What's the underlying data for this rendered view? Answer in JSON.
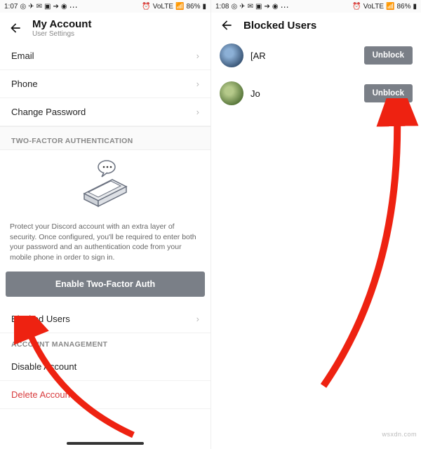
{
  "left": {
    "status": {
      "time": "1:07",
      "battery": "86%",
      "net": "VoLTE"
    },
    "title": "My Account",
    "subtitle": "User Settings",
    "rows": {
      "email_label": "Email",
      "email_value": "",
      "phone_label": "Phone",
      "password_label": "Change Password"
    },
    "twofa_header": "TWO-FACTOR AUTHENTICATION",
    "twofa_desc": "Protect your Discord account with an extra layer of security. Once configured, you'll be required to enter both your password and an authentication code from your mobile phone in order to sign in.",
    "enable_btn": "Enable Two-Factor Auth",
    "blocked_label": "Blocked Users",
    "mgmt_header": "ACCOUNT MANAGEMENT",
    "disable_label": "Disable Account",
    "delete_label": "Delete Account"
  },
  "right": {
    "status": {
      "time": "1:08",
      "battery": "86%",
      "net": "VoLTE"
    },
    "title": "Blocked Users",
    "users": [
      {
        "name": "[AR",
        "btn": "Unblock"
      },
      {
        "name": "Jo",
        "btn": "Unblock"
      }
    ]
  },
  "watermark": "wsxdn.com"
}
